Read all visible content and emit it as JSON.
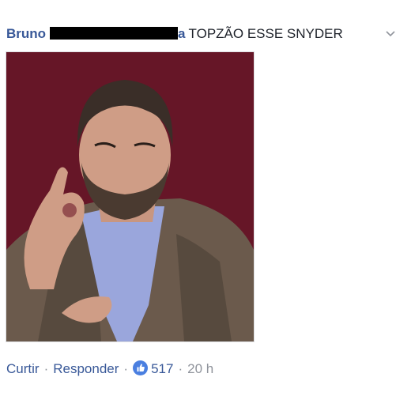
{
  "comment": {
    "author": "Bruno",
    "author_name_tail": "a",
    "text": "TOPZÃO ESSE SNYDER",
    "actions": {
      "like_label": "Curtir",
      "reply_label": "Responder",
      "separator": "·"
    },
    "reactions": {
      "count": "517",
      "icon": "thumbs-up-icon"
    },
    "timestamp": "20 h"
  },
  "colors": {
    "link": "#385898",
    "text": "#1d2129",
    "muted": "#90949c",
    "like_badge": "#4a7fe0",
    "photo_background": "#6e1a2b"
  }
}
